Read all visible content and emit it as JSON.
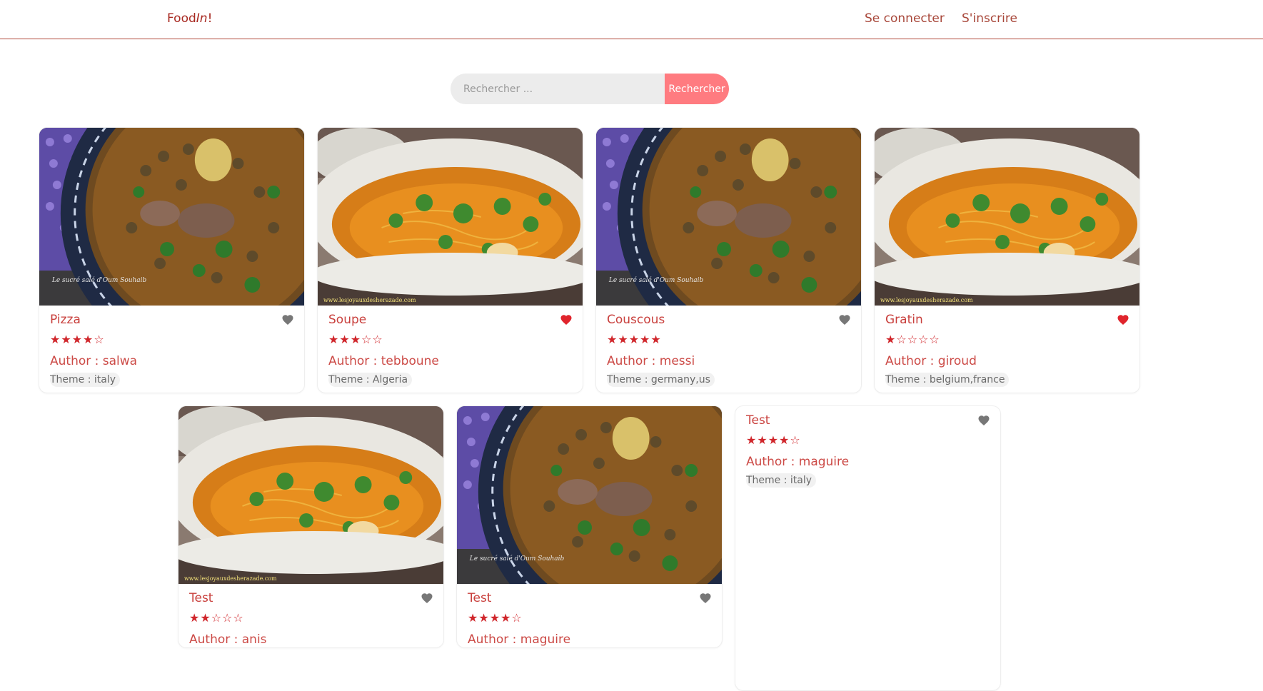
{
  "nav": {
    "brand_prefix": "Food",
    "brand_italic": "In",
    "brand_suffix": "!",
    "login_label": "Se connecter",
    "signup_label": "S'inscrire"
  },
  "search": {
    "placeholder": "Rechercher ...",
    "button_label": "Rechercher"
  },
  "colors": {
    "accent": "#ff7b80",
    "title": "#c9403d",
    "star": "#d0262b",
    "heart_active": "#e0242c",
    "heart_inactive": "#777777"
  },
  "recipes": [
    {
      "title": "Pizza",
      "stars": "★★★★☆",
      "rating": 4,
      "author": "Author : salwa",
      "theme": "Theme : italy",
      "favorite": false,
      "image": "lentil-dish"
    },
    {
      "title": "Soupe",
      "stars": "★★★☆☆",
      "rating": 3,
      "author": "Author : tebboune",
      "theme": "Theme : Algeria",
      "favorite": true,
      "image": "soup-bowl"
    },
    {
      "title": "Couscous",
      "stars": "★★★★★",
      "rating": 5,
      "author": "Author : messi",
      "theme": "Theme : germany,us",
      "favorite": false,
      "image": "lentil-dish"
    },
    {
      "title": "Gratin",
      "stars": "★☆☆☆☆",
      "rating": 1,
      "author": "Author : giroud",
      "theme": "Theme : belgium,france",
      "favorite": true,
      "image": "soup-bowl"
    },
    {
      "title": "Test",
      "stars": "★★☆☆☆",
      "rating": 2,
      "author": "Author : anis",
      "theme": "",
      "favorite": false,
      "image": "soup-bowl"
    },
    {
      "title": "Test",
      "stars": "★★★★☆",
      "rating": 4,
      "author": "Author : maguire",
      "theme": "",
      "favorite": false,
      "image": "lentil-dish"
    },
    {
      "title": "Test",
      "stars": "★★★★☆",
      "rating": 4,
      "author": "Author : maguire",
      "theme": "Theme : italy",
      "favorite": false,
      "image": ""
    }
  ],
  "image_captions": {
    "lentil-dish": "Le sucré salé d'Oum Souhaib",
    "soup-bowl": "www.lesjoyauxdesherazade.com"
  }
}
